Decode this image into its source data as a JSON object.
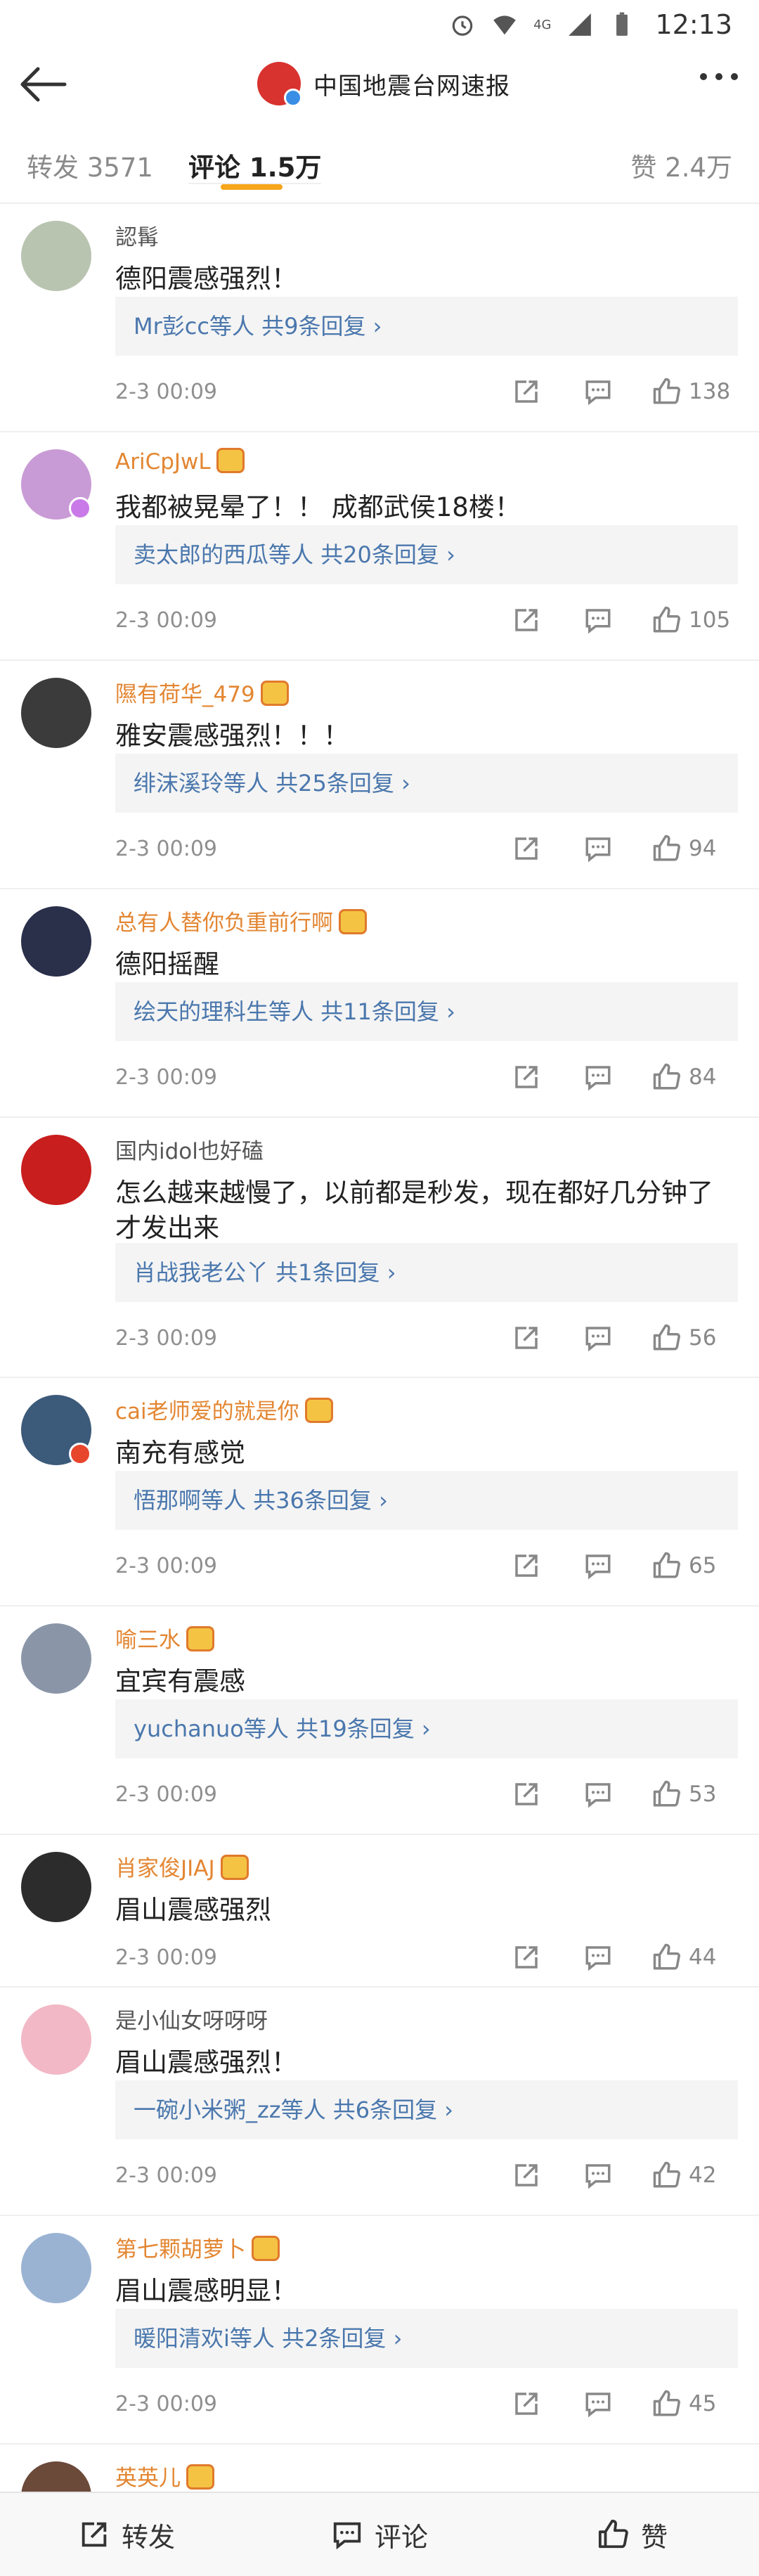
{
  "status_bar": {
    "icons": [
      "alarm-icon",
      "wifi-icon",
      "signal-4g-icon",
      "signal-icon",
      "battery-icon"
    ],
    "network_label": "4G",
    "time": "12:13"
  },
  "header": {
    "title": "中国地震台网速报",
    "back_icon": "arrow-left-icon",
    "more_icon": "more-dots-icon"
  },
  "tabs": {
    "repost": "转发 3571",
    "comment": "评论 1.5万",
    "like": "赞 2.4万",
    "active": "comment",
    "accent_color": "#f7a51c"
  },
  "comments": [
    {
      "name": "認髯",
      "vip": false,
      "text": "德阳震感强烈！",
      "replies": "Mr彭cc等人 共9条回复 ›",
      "time": "2-3 00:09",
      "likes": "138"
    },
    {
      "name": "AriCpJwL",
      "vip": true,
      "text": "我都被晃晕了！！ 成都武侯18楼！",
      "replies": "卖太郎的西瓜等人 共20条回复 ›",
      "time": "2-3 00:09",
      "likes": "105"
    },
    {
      "name": "隰有荷华_479",
      "vip": true,
      "text": "雅安震感强烈！！！",
      "replies": "绯沫溪玲等人 共25条回复 ›",
      "time": "2-3 00:09",
      "likes": "94"
    },
    {
      "name": "总有人替你负重前行啊",
      "vip": true,
      "text": "德阳摇醒",
      "replies": "绘天的理科生等人 共11条回复 ›",
      "time": "2-3 00:09",
      "likes": "84"
    },
    {
      "name": "国内idol也好磕",
      "vip": false,
      "text": "怎么越来越慢了，以前都是秒发，现在都好几分钟了才发出来",
      "replies": "肖战我老公丫 共1条回复 ›",
      "time": "2-3 00:09",
      "likes": "56"
    },
    {
      "name": "cai老师爱的就是你",
      "vip": true,
      "text": "南充有感觉",
      "replies": "悟那啊等人 共36条回复 ›",
      "time": "2-3 00:09",
      "likes": "65"
    },
    {
      "name": "喻三水",
      "vip": true,
      "text": "宜宾有震感",
      "replies": "yuchanuo等人 共19条回复 ›",
      "time": "2-3 00:09",
      "likes": "53"
    },
    {
      "name": "肖家俊JIAJ",
      "vip": true,
      "text": "眉山震感强烈",
      "replies": "",
      "time": "2-3 00:09",
      "likes": "44"
    },
    {
      "name": "是小仙女呀呀呀",
      "vip": false,
      "text": "眉山震感强烈！",
      "replies": "一碗小米粥_zz等人 共6条回复 ›",
      "time": "2-3 00:09",
      "likes": "42"
    },
    {
      "name": "第七颗胡萝卜",
      "vip": true,
      "text": "眉山震感明显！",
      "replies": "暖阳清欢i等人 共2条回复 ›",
      "time": "2-3 00:09",
      "likes": "45"
    },
    {
      "name": "英英儿",
      "vip": true,
      "text": "",
      "replies": "",
      "time": "",
      "likes": ""
    }
  ],
  "colors": {
    "vip_name": "#e38632",
    "reply_link": "#4a77ad",
    "avatars": [
      "#b9c4b0",
      "#c99bd6",
      "#3b3b3b",
      "#2a2f4a",
      "#c81e1e",
      "#3c5a7a",
      "#8a96a8",
      "#2c2c2c",
      "#f2b8c6",
      "#9ab3d3",
      "#6b4a3a"
    ]
  },
  "bottom_bar": {
    "repost": "转发",
    "comment": "评论",
    "like": "赞"
  }
}
